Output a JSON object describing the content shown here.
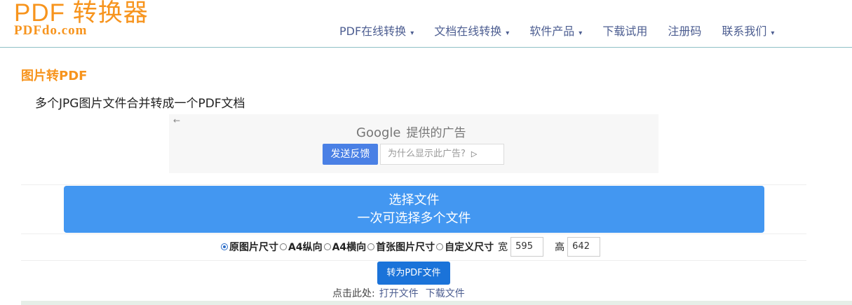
{
  "header": {
    "logo_main": "PDF 转换器",
    "logo_sub": "PDFdo.com",
    "nav": [
      {
        "label": "PDF在线转换",
        "dropdown": true
      },
      {
        "label": "文档在线转换",
        "dropdown": true
      },
      {
        "label": "软件产品",
        "dropdown": true
      },
      {
        "label": "下载试用",
        "dropdown": false
      },
      {
        "label": "注册码",
        "dropdown": false
      },
      {
        "label": "联系我们",
        "dropdown": true
      }
    ]
  },
  "main": {
    "title": "图片转PDF",
    "subtitle": "多个JPG图片文件合并转成一个PDF文档"
  },
  "ad": {
    "back_glyph": "←",
    "brand": "Google",
    "brand_suffix": "提供的广告",
    "feedback_label": "发送反馈",
    "why_label": "为什么显示此广告?"
  },
  "upload": {
    "line1": "选择文件",
    "line2": "一次可选择多个文件"
  },
  "options": {
    "sizes": [
      {
        "label": "原图片尺寸",
        "checked": true
      },
      {
        "label": "A4纵向",
        "checked": false
      },
      {
        "label": "A4横向",
        "checked": false
      },
      {
        "label": "首张图片尺寸",
        "checked": false
      },
      {
        "label": "自定义尺寸",
        "checked": false
      }
    ],
    "width_label": "宽",
    "width_value": "595",
    "height_label": "高",
    "height_value": "642"
  },
  "actions": {
    "convert_label": "转为PDF文件",
    "prompt": "点击此处:",
    "open_label": "打开文件",
    "download_label": "下载文件"
  },
  "colors": {
    "brand_orange": "#f7941d",
    "nav_text": "#4d5e91",
    "upload_blue": "#4397f1",
    "convert_blue": "#1b73d9"
  }
}
